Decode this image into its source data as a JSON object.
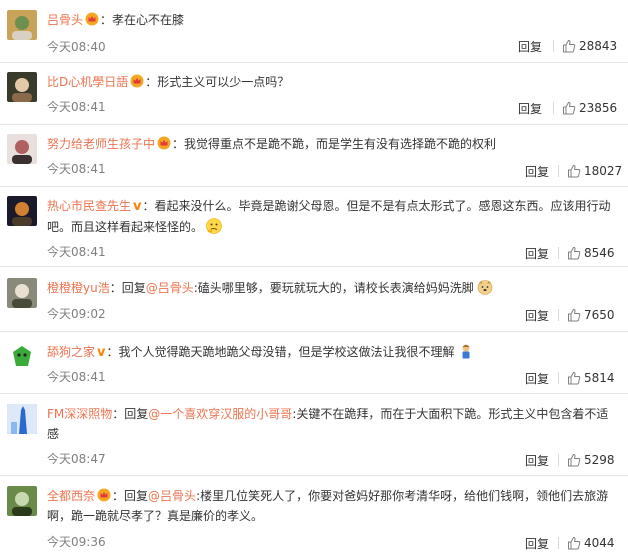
{
  "comments": [
    {
      "username": "吕骨头",
      "badge": "vip",
      "segments": [
        {
          "t": "孝在心不在膝"
        }
      ],
      "time": "今天08:40",
      "reply_label": "回复",
      "likes": "28843",
      "avatar_colors": [
        "#c9a35a",
        "#6d8f4f",
        "#d8d0c0"
      ]
    },
    {
      "username": "比D心机學日語",
      "badge": "vip",
      "segments": [
        {
          "t": "形式主义可以少一点吗？"
        }
      ],
      "time": "今天08:41",
      "reply_label": "回复",
      "likes": "23856",
      "avatar_colors": [
        "#3a3a2a",
        "#e4c9a8",
        "#8a6a4a"
      ]
    },
    {
      "username": "努力给老师生孩子中",
      "badge": "vip",
      "segments": [
        {
          "t": "我觉得重点不是跪不跪，而是学生有没有选择跪不跪的权利"
        }
      ],
      "time": "今天08:41",
      "reply_label": "回复",
      "likes": "18027",
      "avatar_colors": [
        "#e8e0dc",
        "#b06060",
        "#3a3030"
      ]
    },
    {
      "username": "热心市民查先生",
      "badge": "v",
      "segments": [
        {
          "t": "看起来没什么。毕竟是跪谢父母恩。但是不是有点太形式了。感恩这东西。应该用行动吧。而且这样看起来怪怪的。"
        }
      ],
      "emoji": "thinking-face",
      "time": "今天08:41",
      "reply_label": "回复",
      "likes": "8546",
      "avatar_colors": [
        "#1a1a2a",
        "#d08030",
        "#4a3a2a"
      ]
    },
    {
      "username": "橙橙橙yu浩",
      "badge": "",
      "segments": [
        {
          "t": "回复"
        },
        {
          "t": "@吕骨头",
          "at": true
        },
        {
          "t": ":磕头哪里够，要玩就玩大的，请校长表演给妈妈洗脚"
        }
      ],
      "emoji": "dog-face",
      "time": "今天09:02",
      "reply_label": "回复",
      "likes": "7650",
      "avatar_colors": [
        "#8a8a7a",
        "#e8e0d0",
        "#4a4a3a"
      ]
    },
    {
      "username": "舔狗之家",
      "badge": "v",
      "segments": [
        {
          "t": "我个人觉得跪天跪地跪父母没错，但是学校这做法让我很不理解"
        }
      ],
      "emoji": "person-emoji",
      "time": "今天08:41",
      "reply_label": "回复",
      "likes": "5814",
      "avatar_colors": [
        "#ffffff",
        "#3aaa3a",
        "#222222"
      ]
    },
    {
      "username": "FM深深照物",
      "badge": "",
      "segments": [
        {
          "t": "回复"
        },
        {
          "t": "@一个喜欢穿汉服的小哥哥",
          "at": true
        },
        {
          "t": ":关键不在跪拜，而在于大面积下跪。形式主义中包含着不适感"
        }
      ],
      "time": "今天08:47",
      "reply_label": "回复",
      "likes": "5298",
      "avatar_colors": [
        "#2a6acc",
        "#8ab8ee",
        "#dde8f8"
      ]
    },
    {
      "username": "全都西奈",
      "badge": "vip",
      "segments": [
        {
          "t": "回复"
        },
        {
          "t": "@吕骨头",
          "at": true
        },
        {
          "t": ":楼里几位笑死人了，你要对爸妈好那你考清华呀，给他们钱啊，领他们去旅游啊，跪一跪就尽孝了？真是廉价的孝义。"
        }
      ],
      "time": "今天09:36",
      "reply_label": "回复",
      "likes": "4044",
      "avatar_colors": [
        "#6a8a4a",
        "#c8d8b0",
        "#2a3a1a"
      ]
    }
  ]
}
